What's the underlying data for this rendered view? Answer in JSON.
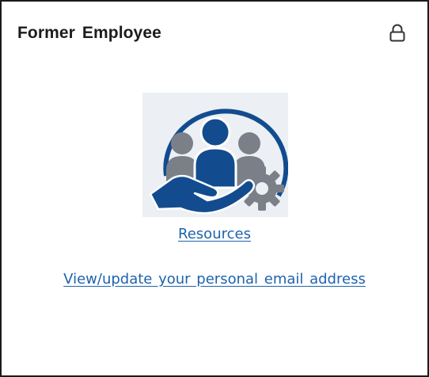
{
  "card": {
    "title": "Former Employee",
    "lock_icon": "lock-icon",
    "illustration_icon": "people-hand-gear-icon",
    "links": {
      "resources": "Resources",
      "personal_email": "View/update your personal email address"
    }
  },
  "colors": {
    "brand_blue": "#124c8f",
    "figure_gray": "#7b8088",
    "link_blue": "#1d63ad",
    "title_text": "#1c1c1c"
  }
}
